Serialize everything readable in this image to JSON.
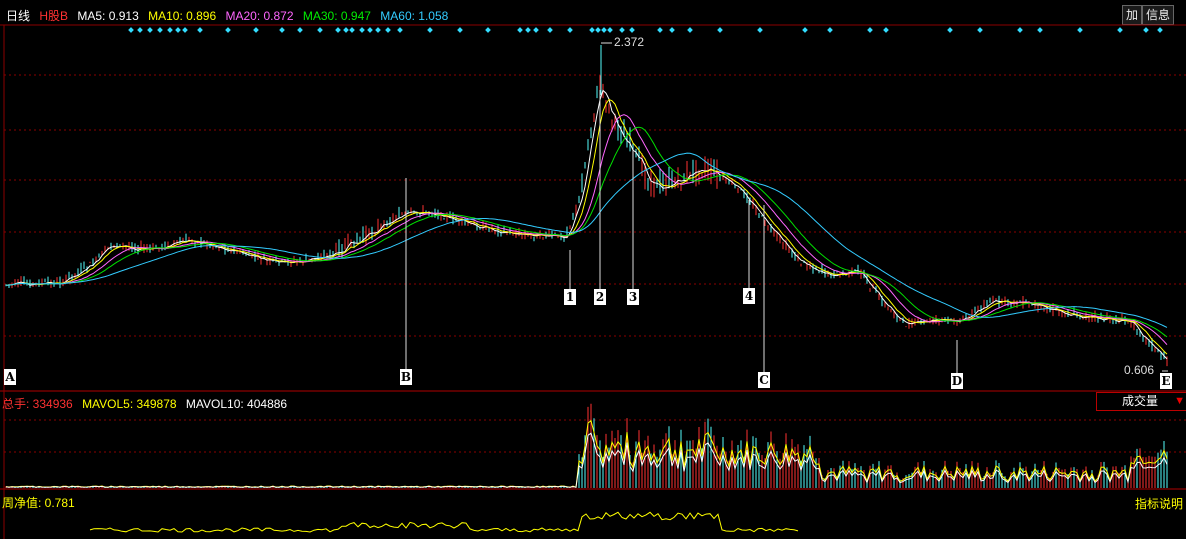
{
  "header": {
    "period": "日线",
    "stock_name": "H股B",
    "ma": [
      {
        "label": "MA5: 0.913",
        "color": "#ffffff"
      },
      {
        "label": "MA10: 0.896",
        "color": "#ffff00"
      },
      {
        "label": "MA20: 0.872",
        "color": "#ff66ff"
      },
      {
        "label": "MA30: 0.947",
        "color": "#00e000"
      },
      {
        "label": "MA60: 1.058",
        "color": "#33ccff"
      }
    ],
    "buttons": [
      "加",
      "信息"
    ]
  },
  "price_chart": {
    "high_label": "2.372",
    "low_label": "0.606",
    "markers": [
      "A",
      "B",
      "1",
      "2",
      "3",
      "4",
      "C",
      "D",
      "E"
    ]
  },
  "volume_panel": {
    "total": {
      "label": "总手: ",
      "value": "334936"
    },
    "mavol5": "MAVOL5: 349878",
    "mavol10": "MAVOL10: 404886",
    "selector": "成交量"
  },
  "indicator_panel": {
    "label": "周净值: 0.781",
    "button": "指标说明"
  },
  "colors": {
    "up": "#ff3232",
    "down": "#54fcfc",
    "grid": "#8b0000",
    "ma5": "#ffffff",
    "ma10": "#ffff00",
    "ma20": "#ff66ff",
    "ma30": "#00e000",
    "ma60": "#33ccff"
  }
}
